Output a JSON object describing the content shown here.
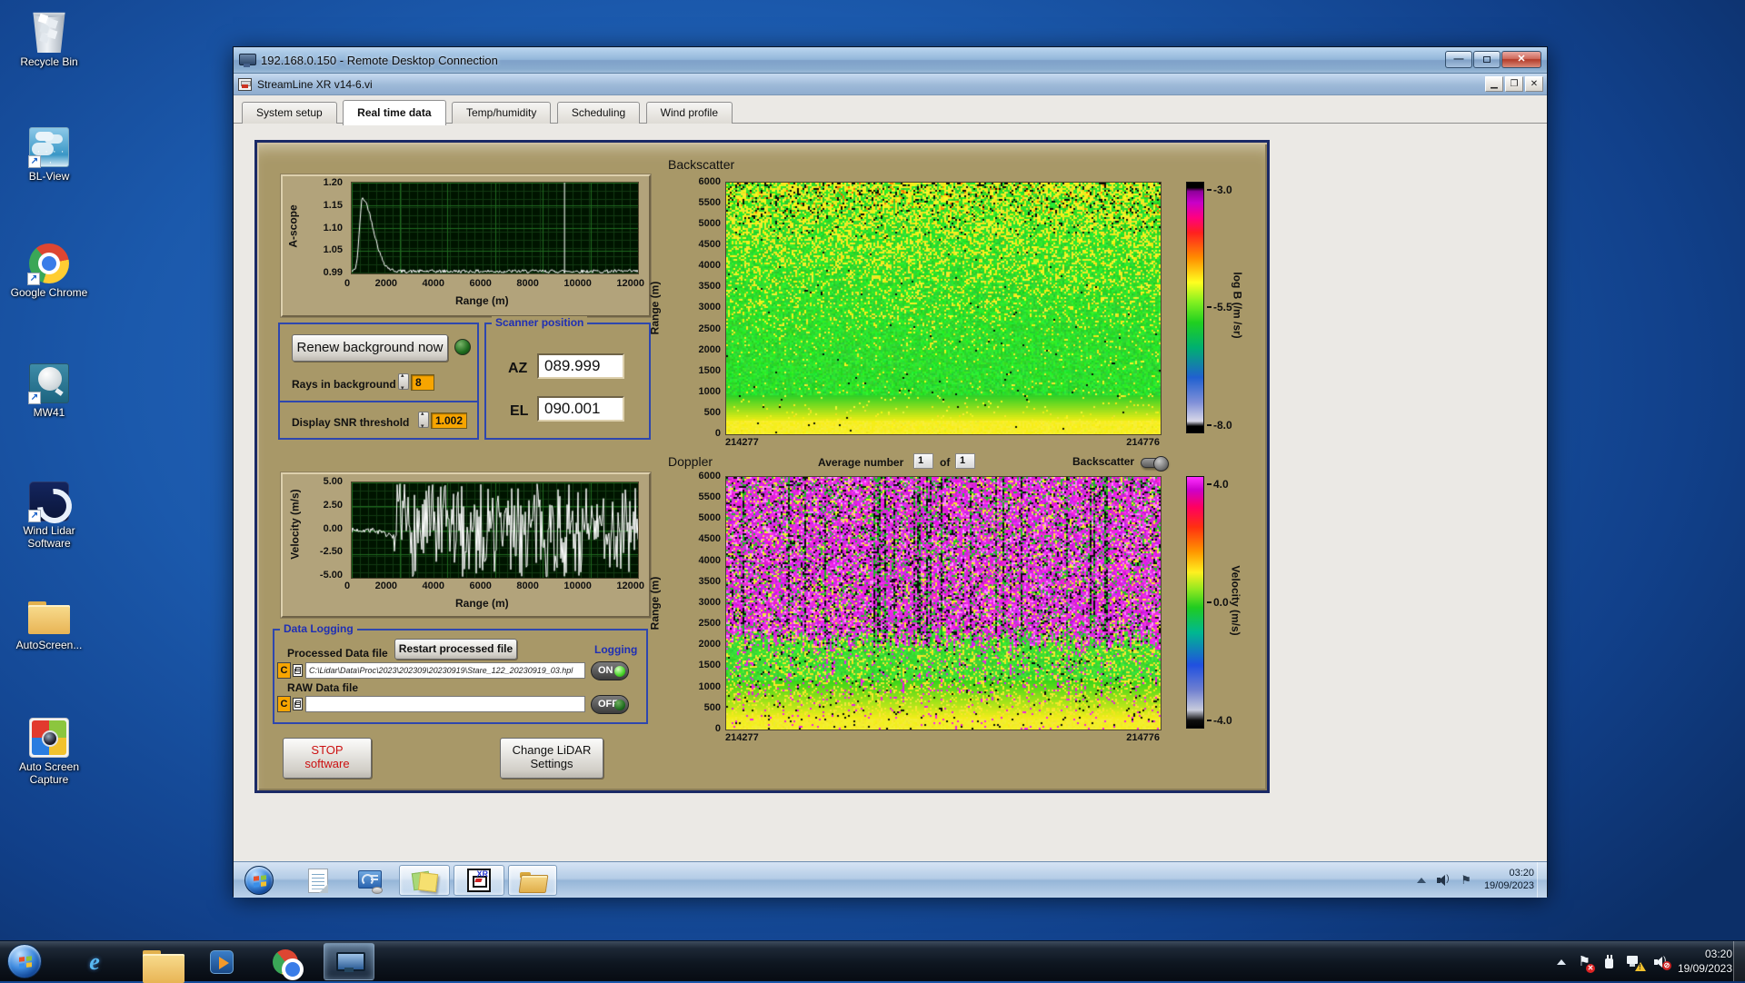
{
  "colors": {
    "desktop_bg": "#1b59ac",
    "panel_tan": "#a89868",
    "group_border_blue": "#2e47ae",
    "label_blue": "#1f2fb4",
    "plot_bg": "#001400",
    "grid_green": "#1d5c1d",
    "trace_white": "#ffffff",
    "orange_field": "#f7a500",
    "stop_red": "#cc1111"
  },
  "desktop": {
    "icons": [
      {
        "name": "recycle-bin",
        "label": "Recycle Bin"
      },
      {
        "name": "bl-view",
        "label": "BL-View"
      },
      {
        "name": "google-chrome",
        "label": "Google Chrome"
      },
      {
        "name": "mw41",
        "label": "MW41"
      },
      {
        "name": "wind-lidar-software",
        "label": "Wind Lidar Software"
      },
      {
        "name": "autoscreen",
        "label": "AutoScreen..."
      },
      {
        "name": "auto-screen-capture",
        "label": "Auto Screen Capture"
      }
    ]
  },
  "rdp_window": {
    "title": "192.168.0.150 - Remote Desktop Connection"
  },
  "app_window": {
    "title": "StreamLine XR v14-6.vi",
    "tabs": [
      {
        "label": "System setup"
      },
      {
        "label": "Real time data"
      },
      {
        "label": "Temp/humidity"
      },
      {
        "label": "Scheduling"
      },
      {
        "label": "Wind profile"
      }
    ]
  },
  "panel": {
    "renew_button": "Renew background now",
    "rays_label": "Rays in background",
    "rays_value": "8",
    "snr_label": "Display SNR threshold",
    "snr_value": "1.002",
    "scanner": {
      "title": "Scanner position",
      "az_label": "AZ",
      "az_value": "089.999",
      "el_label": "EL",
      "el_value": "090.001"
    },
    "average": {
      "label": "Average number",
      "value1": "1",
      "of": "of",
      "value2": "1"
    },
    "backscatter_toggle_label": "Backscatter",
    "data_logging": {
      "title": "Data Logging",
      "processed_label": "Processed Data file",
      "restart_button": "Restart processed file",
      "logging_label": "Logging",
      "drive_button": "C",
      "processed_path": "C:\\Lidar\\Data\\Proc\\2023\\202309\\20230919\\Stare_122_20230919_03.hpl",
      "on_label": "ON",
      "raw_label": "RAW Data file",
      "raw_path": "",
      "off_label": "OFF"
    },
    "stop_button_line1": "STOP",
    "stop_button_line2": "software",
    "change_button_line1": "Change LiDAR",
    "change_button_line2": "Settings"
  },
  "chart_data": {
    "ascope": {
      "type": "line",
      "ylabel": "A-scope",
      "xlabel": "Range (m)",
      "xlim": [
        0,
        12000
      ],
      "ylim": [
        0.99,
        1.2
      ],
      "x_ticks": [
        "0",
        "2000",
        "4000",
        "6000",
        "8000",
        "10000",
        "12000"
      ],
      "y_ticks": [
        "1.20",
        "1.15",
        "1.10",
        "1.05",
        "0.99"
      ],
      "baseline": 0.995,
      "peak_x": 450,
      "peak_y": 1.163,
      "vline_x": 8900,
      "noise": 0.004
    },
    "velocity": {
      "type": "line",
      "ylabel": "Velocity (m/s)",
      "xlabel": "Range (m)",
      "xlim": [
        0,
        12000
      ],
      "ylim": [
        -5,
        5
      ],
      "x_ticks": [
        "0",
        "2000",
        "4000",
        "6000",
        "8000",
        "10000",
        "12000"
      ],
      "y_ticks": [
        "5.00",
        "2.50",
        "0.00",
        "-2.50",
        "-5.00"
      ],
      "segments": [
        {
          "from": 0,
          "to": 1900,
          "mode": "calm",
          "amp": 0.5
        },
        {
          "from": 1900,
          "to": 6800,
          "mode": "saturated",
          "amp": 4.9
        },
        {
          "from": 6800,
          "to": 12000,
          "mode": "sparse",
          "amp": 4.9
        }
      ]
    },
    "backscatter": {
      "type": "heatmap",
      "title": "Backscatter",
      "ylabel": "Range (m)",
      "ylim": [
        0,
        6000
      ],
      "y_ticks": [
        "6000",
        "5500",
        "5000",
        "4500",
        "4000",
        "3500",
        "3000",
        "2500",
        "2000",
        "1500",
        "1000",
        "500",
        "0"
      ],
      "x_left_label": "214277",
      "x_right_label": "214776",
      "colorbar": {
        "label": "log B (/m /sr)",
        "ticks": [
          "-3.0",
          "-5.5",
          "-8.0"
        ],
        "stops": [
          [
            "#000000",
            0
          ],
          [
            "#000000",
            0.02
          ],
          [
            "#90009c",
            0.035
          ],
          [
            "#c800c8",
            0.08
          ],
          [
            "#ff0080",
            0.14
          ],
          [
            "#ff2020",
            0.2
          ],
          [
            "#ff8c00",
            0.3
          ],
          [
            "#ffff20",
            0.4
          ],
          [
            "#80f020",
            0.48
          ],
          [
            "#20d020",
            0.56
          ],
          [
            "#00b070",
            0.66
          ],
          [
            "#2060d0",
            0.78
          ],
          [
            "#8090d8",
            0.88
          ],
          [
            "#d8d8e8",
            0.955
          ],
          [
            "#000000",
            0.975
          ],
          [
            "#000000",
            1
          ]
        ]
      },
      "appearance": {
        "base_green": "#2bd42b",
        "speckle_yellow": "#f2f21e",
        "bottom_yellow_band_m": 500
      }
    },
    "doppler": {
      "type": "heatmap",
      "title": "Doppler",
      "ylabel": "Range (m)",
      "ylim": [
        0,
        6000
      ],
      "y_ticks": [
        "6000",
        "5500",
        "5000",
        "4500",
        "4000",
        "3500",
        "3000",
        "2500",
        "2000",
        "1500",
        "1000",
        "500",
        "0"
      ],
      "x_left_label": "214277",
      "x_right_label": "214776",
      "colorbar": {
        "label": "Velocity (m/s)",
        "ticks": [
          "4.0",
          "0.0",
          "-4.0"
        ],
        "stops": [
          [
            "#ff30ff",
            0
          ],
          [
            "#cc00cc",
            0.05
          ],
          [
            "#ff0060",
            0.12
          ],
          [
            "#ff3010",
            0.2
          ],
          [
            "#ff9800",
            0.3
          ],
          [
            "#fff020",
            0.38
          ],
          [
            "#90e820",
            0.45
          ],
          [
            "#20cc20",
            0.52
          ],
          [
            "#00b890",
            0.62
          ],
          [
            "#2050e0",
            0.75
          ],
          [
            "#7080d0",
            0.85
          ],
          [
            "#c8ccdc",
            0.93
          ],
          [
            "#101010",
            0.97
          ],
          [
            "#000000",
            1
          ]
        ]
      },
      "appearance": {
        "magenta": "#e820d8",
        "magenta_zone_top_m": 6000,
        "magenta_zone_bottom_m": 2100
      }
    }
  },
  "inner_taskbar": {
    "clock_time": "03:20",
    "clock_date": "19/09/2023",
    "icons": [
      "start",
      "notepad",
      "control-panel",
      "sticky-notes",
      "streamline-xr",
      "windows-explorer"
    ],
    "tray_icons": [
      "tray-expand",
      "volume",
      "flag"
    ]
  },
  "outer_taskbar": {
    "clock_time": "03:20",
    "clock_date": "19/09/2023",
    "icons": [
      "start",
      "internet-explorer",
      "windows-explorer",
      "media-player",
      "chrome",
      "remote-desktop"
    ],
    "tray_icons": [
      "tray-expand",
      "action-center-flag",
      "power-plug",
      "network-warning",
      "volume-muted"
    ]
  }
}
